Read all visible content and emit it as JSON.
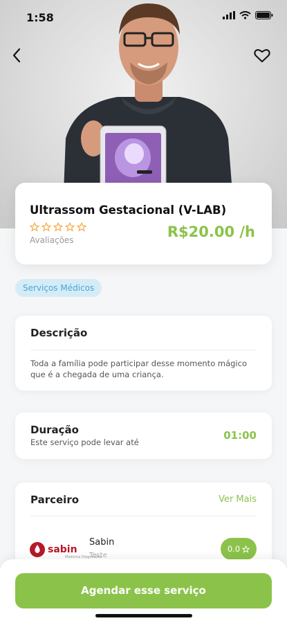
{
  "status_bar": {
    "time": "1:58"
  },
  "product": {
    "title": "Ultrassom Gestacional (V-LAB)",
    "rating_stars": 0,
    "rating_max": 5,
    "rating_label": "Avaliações",
    "price": "R$20.00 /h"
  },
  "category": "Serviços Médicos",
  "description": {
    "title": "Descrição",
    "text": "Toda a família pode participar desse momento mágico que é a chegada de uma criança."
  },
  "duration": {
    "title": "Duração",
    "subtitle": "Este serviço pode levar até",
    "value": "01:00"
  },
  "partner": {
    "title": "Parceiro",
    "see_more": "Ver Mais",
    "logo_text": "sabin",
    "logo_subtext": "Medicina Diagnóstica",
    "name": "Sabin",
    "subtitle": "Teste",
    "rating": "0.0"
  },
  "cta": {
    "label": "Agendar esse serviço"
  },
  "colors": {
    "accent": "#8bc34a",
    "chip_bg": "#d5ecf7",
    "chip_text": "#47a7d3",
    "star": "#f4a63a"
  }
}
